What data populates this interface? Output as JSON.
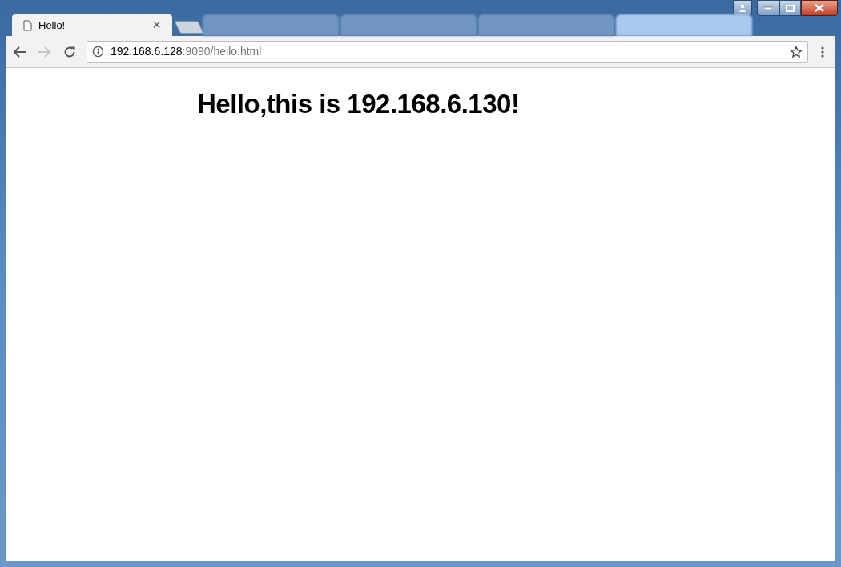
{
  "tabs": [
    {
      "kind": "page",
      "title": "Hello!",
      "close": "×",
      "selected": true
    },
    {
      "kind": "new"
    },
    {
      "kind": "blurred",
      "selected": false
    },
    {
      "kind": "blurred",
      "selected": false
    },
    {
      "kind": "blurred",
      "selected": false
    },
    {
      "kind": "blurred",
      "selected": true
    }
  ],
  "address_bar": {
    "host": "192.168.6.128",
    "rest": ":9090/hello.html"
  },
  "page": {
    "heading": "Hello,this is 192.168.6.130!"
  }
}
